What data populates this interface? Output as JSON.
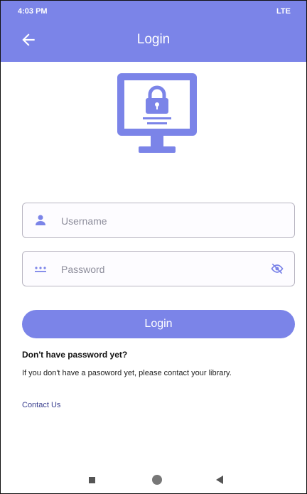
{
  "status_bar": {
    "time": "4:03 PM",
    "right": "LTE"
  },
  "app_bar": {
    "title": "Login"
  },
  "form": {
    "username_placeholder": "Username",
    "password_placeholder": "Password",
    "login_label": "Login"
  },
  "help": {
    "heading": "Don't have password yet?",
    "text": "If you don't have a pasoword yet, please contact your library.",
    "contact_label": "Contact Us"
  },
  "icons": {
    "back": "arrow-back-icon",
    "illustration": "monitor-lock-icon",
    "username": "person-icon",
    "password": "password-dots-icon",
    "visibility": "eye-off-icon"
  },
  "colors": {
    "primary": "#7b84e8",
    "background": "#ffffff",
    "text": "#111111",
    "link": "#3a3f8f"
  }
}
